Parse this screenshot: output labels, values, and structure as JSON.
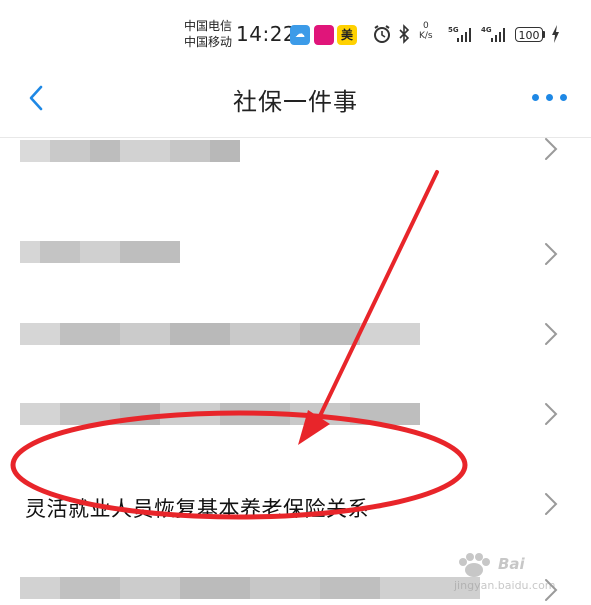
{
  "status_bar": {
    "carrier_1": "中国电信",
    "carrier_2": "中国移动",
    "time": "14:22",
    "speed_value": "0",
    "speed_unit": "K/s",
    "net_1": "5G",
    "net_2": "4G",
    "battery": "100"
  },
  "nav": {
    "title": "社保一件事"
  },
  "list": {
    "highlighted_item": "灵活就业人员恢复基本养老保险关系"
  },
  "watermark": {
    "brand": "Bai",
    "url": "jingyan.baidu.com"
  },
  "colors": {
    "accent": "#1e88e5",
    "annotation": "#e8252a"
  }
}
